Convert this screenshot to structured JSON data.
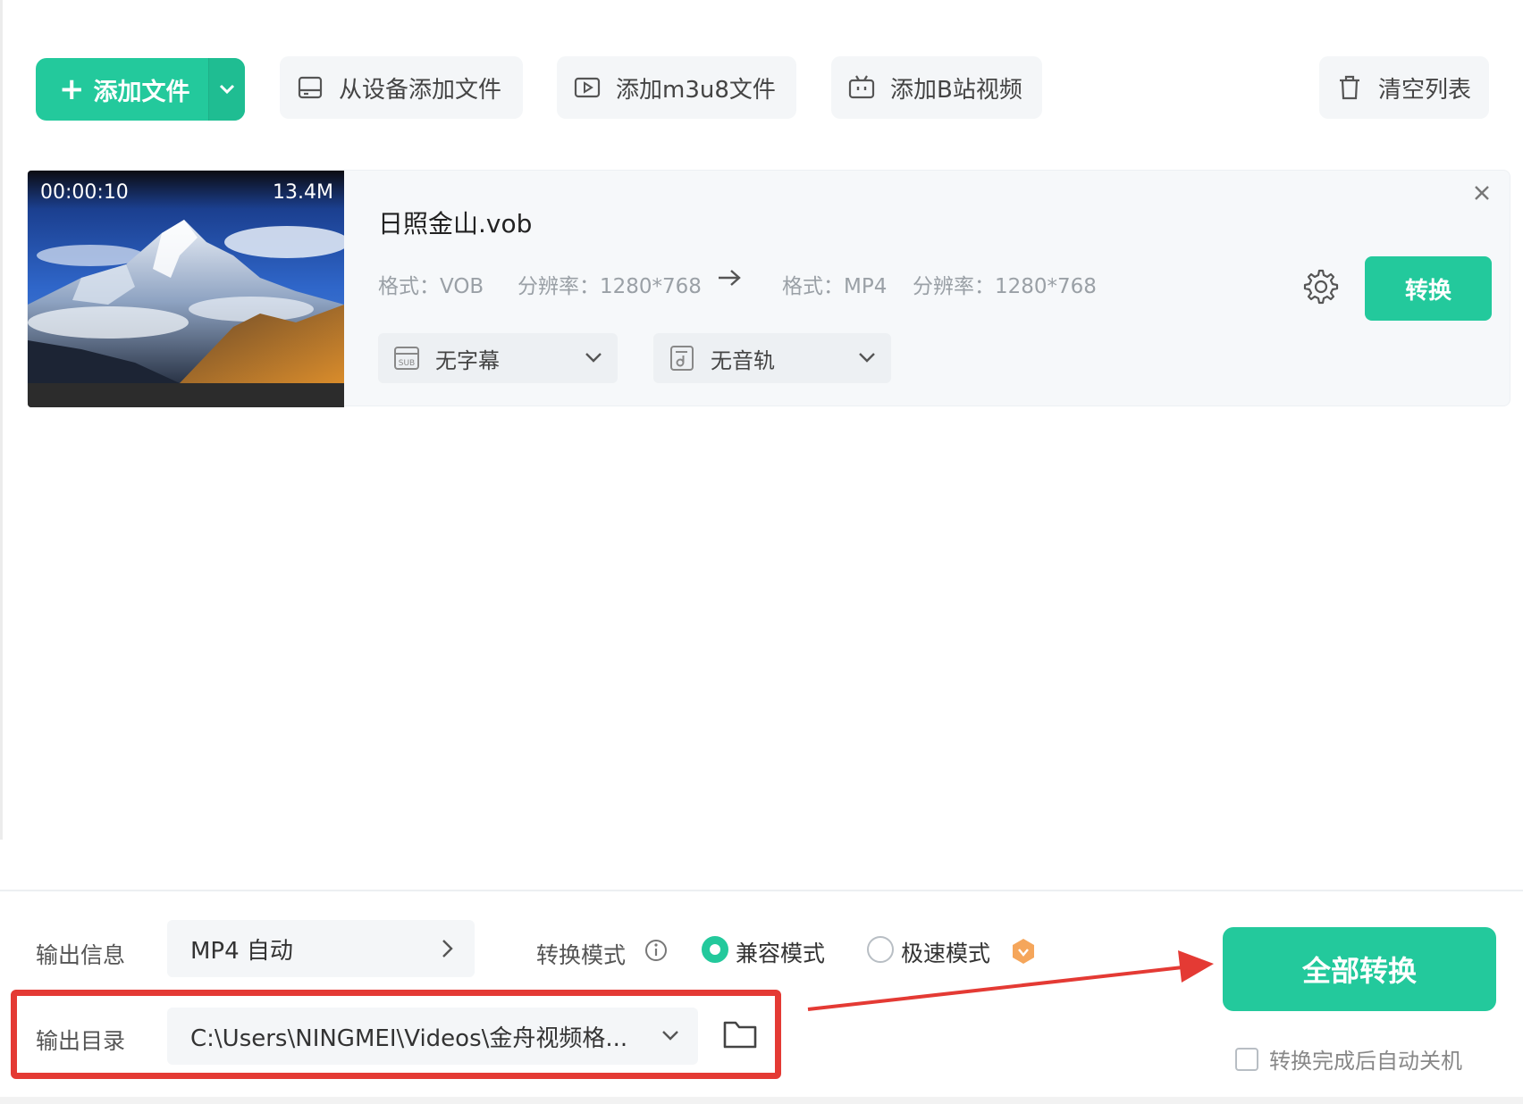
{
  "toolbar": {
    "add_file_label": "添加文件",
    "add_from_device_label": "从设备添加文件",
    "add_m3u8_label": "添加m3u8文件",
    "add_bilibili_label": "添加B站视频",
    "clear_list_label": "清空列表"
  },
  "file": {
    "duration": "00:00:10",
    "size": "13.4M",
    "name": "日照金山.vob",
    "src_format": "格式：VOB",
    "src_resolution": "分辨率：1280*768",
    "dst_format": "格式：MP4",
    "dst_resolution": "分辨率：1280*768",
    "subtitle_select": "无字幕",
    "audio_select": "无音轨",
    "convert_label": "转换"
  },
  "bottom": {
    "output_info_label": "输出信息",
    "output_info_value": "MP4 自动",
    "convert_mode_label": "转换模式",
    "mode_compatible": "兼容模式",
    "mode_fast": "极速模式",
    "selected_mode": "兼容模式",
    "output_dir_label": "输出目录",
    "output_dir_value": "C:\\Users\\NINGMEI\\Videos\\金舟视频格...",
    "convert_all_label": "全部转换",
    "shutdown_label": "转换完成后自动关机",
    "shutdown_checked": false
  },
  "colors": {
    "accent": "#23c99c",
    "highlight": "#e43a34",
    "vip_badge": "#f5a65b"
  }
}
